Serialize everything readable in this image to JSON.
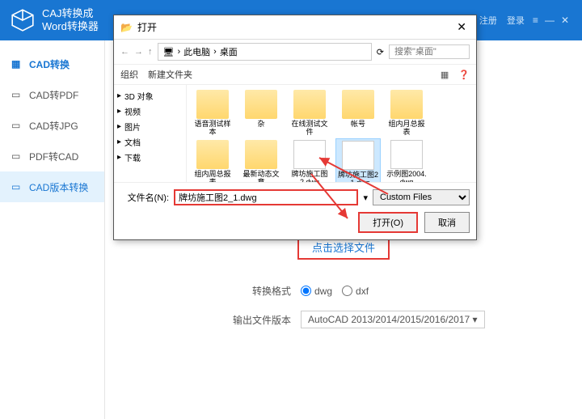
{
  "header": {
    "title_line1": "CAJ转换成",
    "title_line2": "Word转换器",
    "register": "注册",
    "login": "登录"
  },
  "sidebar": {
    "items": [
      {
        "label": "CAD转换",
        "heading": true
      },
      {
        "label": "CAD转PDF"
      },
      {
        "label": "CAD转JPG"
      },
      {
        "label": "PDF转CAD"
      },
      {
        "label": "CAD版本转换",
        "active": true
      }
    ]
  },
  "dialog": {
    "title": "打开",
    "path_parts": [
      "此电脑",
      "桌面"
    ],
    "search_placeholder": "搜索\"桌面\"",
    "organize": "组织",
    "new_folder": "新建文件夹",
    "tree": [
      {
        "label": "3D 对象"
      },
      {
        "label": "视频"
      },
      {
        "label": "图片"
      },
      {
        "label": "文档"
      },
      {
        "label": "下载"
      }
    ],
    "files_row1": [
      {
        "label": "语音测试样本",
        "type": "folder"
      },
      {
        "label": "杂",
        "type": "folder"
      },
      {
        "label": "在线测试文件",
        "type": "folder"
      },
      {
        "label": "帐号",
        "type": "folder"
      },
      {
        "label": "组内月总报表",
        "type": "folder"
      }
    ],
    "files_row2": [
      {
        "label": "组内周总报表",
        "type": "folder"
      },
      {
        "label": "最新动态文章",
        "type": "folder"
      },
      {
        "label": "牌坊施工图2.dwg",
        "type": "file"
      },
      {
        "label": "牌坊施工图2_1.dwg",
        "type": "file",
        "selected": true
      },
      {
        "label": "示例图2004.dwg",
        "type": "file"
      }
    ],
    "filename_label": "文件名(N):",
    "filename_value": "牌坊施工图2_1.dwg",
    "filter": "Custom Files",
    "open_btn": "打开(O)",
    "cancel_btn": "取消"
  },
  "content": {
    "select_file": "点击选择文件",
    "format_label": "转换格式",
    "format_dwg": "dwg",
    "format_dxf": "dxf",
    "version_label": "输出文件版本",
    "version_value": "AutoCAD 2013/2014/2015/2016/2017 ▾"
  }
}
